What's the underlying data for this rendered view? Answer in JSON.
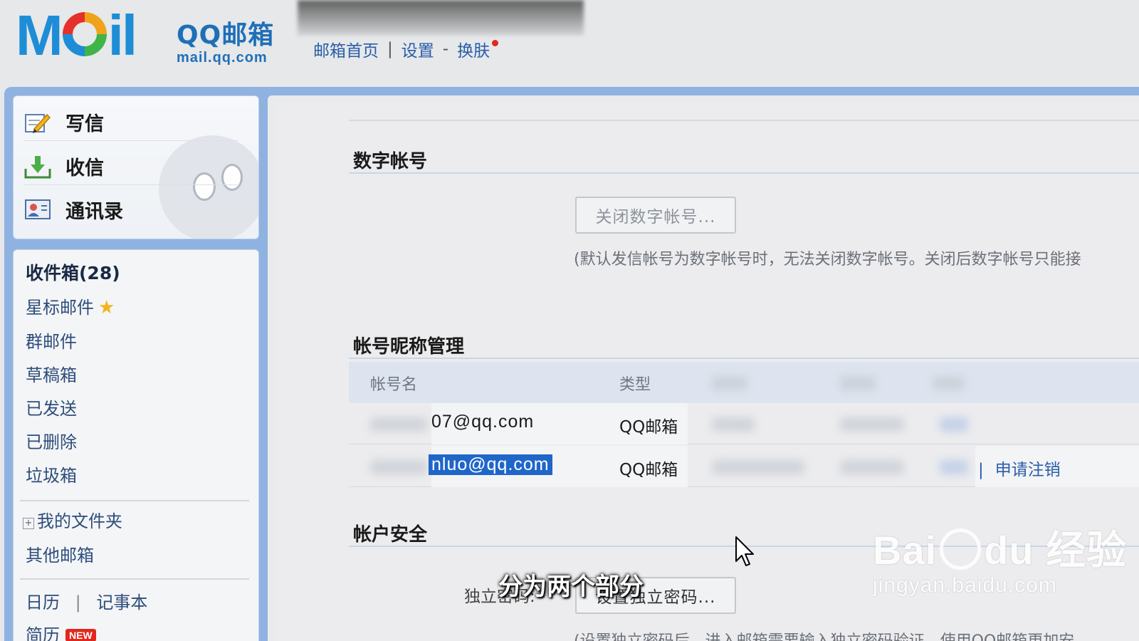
{
  "header": {
    "logo_text": "MOil",
    "brand_name": "QQ邮箱",
    "brand_url": "mail.qq.com",
    "nav": [
      "邮箱首页",
      "设置",
      "换肤"
    ],
    "nav_separators": [
      "|",
      "-"
    ]
  },
  "actions": [
    {
      "label": "写信",
      "icon": "compose-icon"
    },
    {
      "label": "收信",
      "icon": "inbox-download-icon"
    },
    {
      "label": "通讯录",
      "icon": "contacts-icon"
    }
  ],
  "folders": {
    "inbox": "收件箱(28)",
    "starred": "星标邮件",
    "group": "群邮件",
    "drafts": "草稿箱",
    "sent": "已发送",
    "deleted": "已删除",
    "junk": "垃圾箱",
    "my_folders": "我的文件夹",
    "other_mailboxes": "其他邮箱",
    "calendar": "日历",
    "notebook": "记事本",
    "resume": "简历",
    "new_badge": "NEW"
  },
  "sections": {
    "digital_account": {
      "title": "数字帐号",
      "button": "关闭数字帐号...",
      "note": "(默认发信帐号为数字帐号时，无法关闭数字帐号。关闭后数字帐号只能接"
    },
    "nickname": {
      "title": "帐号昵称管理",
      "columns": [
        "帐号名",
        "类型"
      ],
      "rows": [
        {
          "account": "07@qq.com",
          "type": "QQ邮箱",
          "action": ""
        },
        {
          "account": "nluo@qq.com",
          "type": "QQ邮箱",
          "action": "申请注销"
        }
      ]
    },
    "security": {
      "title": "帐户安全",
      "label": "独立密码:",
      "button": "设置独立密码...",
      "note": "(设置独立密码后，进入邮箱需要输入独立密码验证，使用QQ邮箱更加安"
    }
  },
  "overlay": {
    "subtitle": "分为两个部分",
    "watermark_top": "Bai",
    "watermark_du": "du",
    "watermark_cn": "经验",
    "watermark_url": "jingyan.baidu.com"
  },
  "colors": {
    "accent_blue": "#2a5da8",
    "frame_blue": "#8fb2e0",
    "selection": "#1f66c9",
    "badge_red": "#e2261d"
  }
}
